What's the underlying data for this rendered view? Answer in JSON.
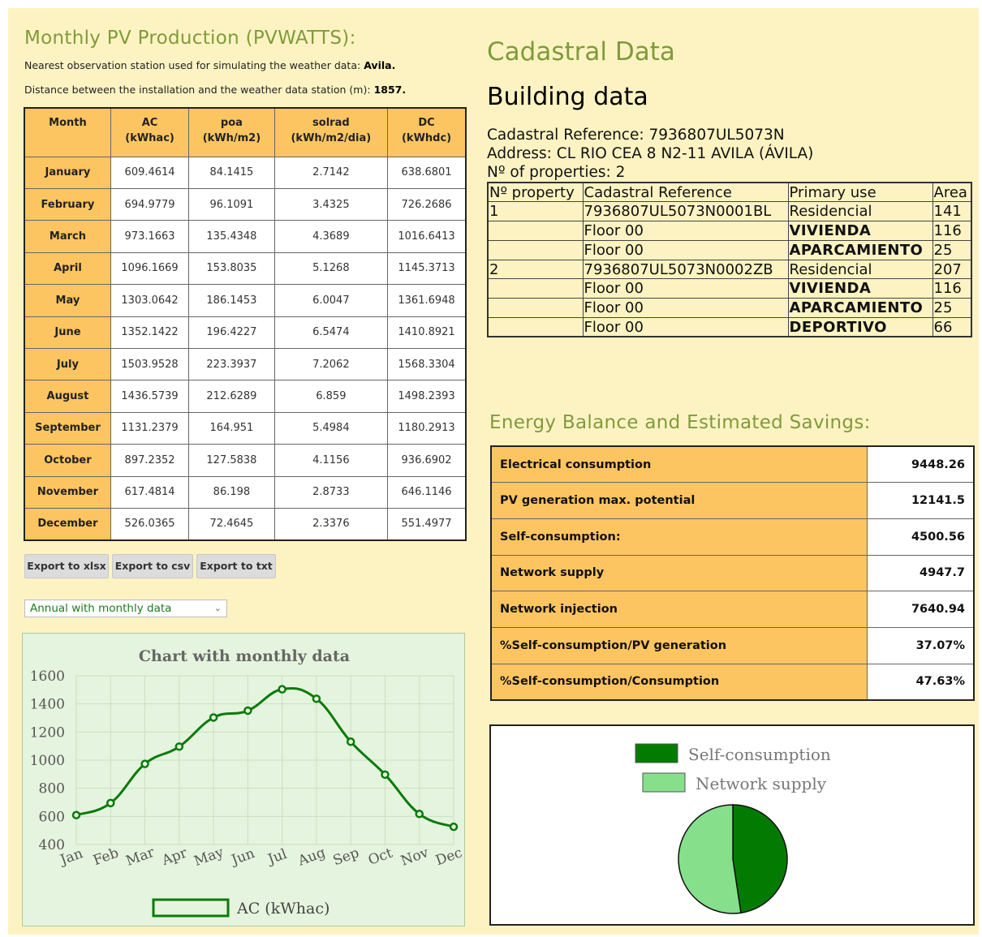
{
  "pv": {
    "title": "Monthly PV Production (PVWATTS):",
    "station_label": "Nearest observation station used for simulating the weather data:",
    "station_value": "Avila.",
    "distance_label": "Distance between the installation and the weather data station (m):",
    "distance_value": "1857.",
    "table": {
      "headers": [
        {
          "l1": "Month",
          "l2": ""
        },
        {
          "l1": "AC",
          "l2": "(kWhac)"
        },
        {
          "l1": "poa",
          "l2": "(kWh/m2)"
        },
        {
          "l1": "solrad",
          "l2": "(kWh/m2/dia)"
        },
        {
          "l1": "DC",
          "l2": "(kWhdc)"
        }
      ],
      "rows": [
        {
          "month": "January",
          "ac": "609.4614",
          "poa": "84.1415",
          "solrad": "2.7142",
          "dc": "638.6801"
        },
        {
          "month": "February",
          "ac": "694.9779",
          "poa": "96.1091",
          "solrad": "3.4325",
          "dc": "726.2686"
        },
        {
          "month": "March",
          "ac": "973.1663",
          "poa": "135.4348",
          "solrad": "4.3689",
          "dc": "1016.6413"
        },
        {
          "month": "April",
          "ac": "1096.1669",
          "poa": "153.8035",
          "solrad": "5.1268",
          "dc": "1145.3713"
        },
        {
          "month": "May",
          "ac": "1303.0642",
          "poa": "186.1453",
          "solrad": "6.0047",
          "dc": "1361.6948"
        },
        {
          "month": "June",
          "ac": "1352.1422",
          "poa": "196.4227",
          "solrad": "6.5474",
          "dc": "1410.8921"
        },
        {
          "month": "July",
          "ac": "1503.9528",
          "poa": "223.3937",
          "solrad": "7.2062",
          "dc": "1568.3304"
        },
        {
          "month": "August",
          "ac": "1436.5739",
          "poa": "212.6289",
          "solrad": "6.859",
          "dc": "1498.2393"
        },
        {
          "month": "September",
          "ac": "1131.2379",
          "poa": "164.951",
          "solrad": "5.4984",
          "dc": "1180.2913"
        },
        {
          "month": "October",
          "ac": "897.2352",
          "poa": "127.5838",
          "solrad": "4.1156",
          "dc": "936.6902"
        },
        {
          "month": "November",
          "ac": "617.4814",
          "poa": "86.198",
          "solrad": "2.8733",
          "dc": "646.1146"
        },
        {
          "month": "December",
          "ac": "526.0365",
          "poa": "72.4645",
          "solrad": "2.3376",
          "dc": "551.4977"
        }
      ]
    },
    "export": {
      "xlsx": "Export to xlsx",
      "csv": "Export to csv",
      "txt": "Export to txt"
    },
    "select_value": "Annual with monthly data"
  },
  "chart_data": [
    {
      "type": "line",
      "title": "Chart with monthly data",
      "categories": [
        "Jan",
        "Feb",
        "Mar",
        "Apr",
        "May",
        "Jun",
        "Jul",
        "Aug",
        "Sep",
        "Oct",
        "Nov",
        "Dec"
      ],
      "series": [
        {
          "name": "AC (kWhac)",
          "values": [
            609.4614,
            694.9779,
            973.1663,
            1096.1669,
            1303.0642,
            1352.1422,
            1503.9528,
            1436.5739,
            1131.2379,
            897.2352,
            617.4814,
            526.0365
          ]
        }
      ],
      "yticks": [
        400,
        600,
        800,
        1000,
        1200,
        1400,
        1600
      ],
      "ylim": [
        400,
        1600
      ],
      "grid": true,
      "legend": "bottom",
      "colors": {
        "line": "#0a7a0a",
        "grid": "#c9dfc2"
      }
    },
    {
      "type": "pie",
      "labels": [
        "Self-consumption",
        "Network supply"
      ],
      "values": [
        4500.56,
        4947.7
      ],
      "colors": [
        "#037b03",
        "#86e08b"
      ],
      "legend": "top"
    }
  ],
  "cadastral": {
    "title": "Cadastral Data",
    "building_title": "Building data",
    "reference_line": "Cadastral Reference: 7936807UL5073N",
    "address_line": "Address: CL RIO CEA 8 N2-11 AVILA (ÁVILA)",
    "properties_line": "Nº of properties: 2",
    "table": {
      "headers": [
        "Nº property",
        "Cadastral Reference",
        "Primary use",
        "Area"
      ],
      "rows": [
        {
          "num": "1",
          "ref": "7936807UL5073N0001BL",
          "use": "Residencial",
          "area": "141",
          "bold": false
        },
        {
          "num": "",
          "ref": "Floor 00",
          "use": "VIVIENDA",
          "area": "116",
          "bold": true
        },
        {
          "num": "",
          "ref": "Floor 00",
          "use": "APARCAMIENTO",
          "area": "25",
          "bold": true
        },
        {
          "num": "2",
          "ref": "7936807UL5073N0002ZB",
          "use": "Residencial",
          "area": "207",
          "bold": false
        },
        {
          "num": "",
          "ref": "Floor 00",
          "use": "VIVIENDA",
          "area": "116",
          "bold": true
        },
        {
          "num": "",
          "ref": "Floor 00",
          "use": "APARCAMIENTO",
          "area": "25",
          "bold": true
        },
        {
          "num": "",
          "ref": "Floor 00",
          "use": "DEPORTIVO",
          "area": "66",
          "bold": true
        }
      ]
    }
  },
  "energy": {
    "title": "Energy Balance and Estimated Savings:",
    "rows": [
      {
        "label": "Electrical consumption",
        "value": "9448.26"
      },
      {
        "label": "PV generation max. potential",
        "value": "12141.5"
      },
      {
        "label": "Self-consumption:",
        "value": "4500.56"
      },
      {
        "label": "Network supply",
        "value": "4947.7"
      },
      {
        "label": "Network injection",
        "value": "7640.94"
      },
      {
        "label": "%Self-consumption/PV generation",
        "value": "37.07%"
      },
      {
        "label": "%Self-consumption/Consumption",
        "value": "47.63%"
      }
    ]
  },
  "colors": {
    "page_bg": "#fdf3c2",
    "section_title": "#7f9b3b",
    "table_header": "#fdc561",
    "chart_bg": "#e5f4de"
  }
}
